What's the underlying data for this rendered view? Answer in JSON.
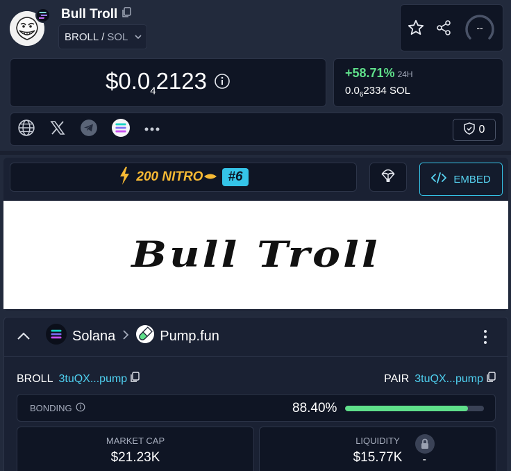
{
  "header": {
    "token_name": "Bull Troll",
    "base_symbol": "BROLL",
    "pair_separator": "/",
    "quote_symbol": "SOL",
    "score_label": "--"
  },
  "price": {
    "usd_prefix": "$0.0",
    "usd_zeros": "4",
    "usd_digits": "2123",
    "change_24h": "+58.71%",
    "change_label": "24H",
    "sol_prefix": "0.0",
    "sol_zeros": "6",
    "sol_digits": "2334",
    "sol_unit": "SOL"
  },
  "socials": {
    "icons": [
      "globe-icon",
      "x-icon",
      "telegram-icon",
      "solana-icon",
      "more-icon"
    ],
    "shield_count": "0"
  },
  "boost": {
    "nitro_amount": "200",
    "nitro_label": "NITRO",
    "rank": "#6",
    "embed_label": "EMBED"
  },
  "banner": {
    "text": "Bull Troll"
  },
  "info": {
    "chain": "Solana",
    "dex": "Pump.fun",
    "token_label": "BROLL",
    "token_address": "3tuQX...pump",
    "pair_label": "PAIR",
    "pair_address": "3tuQX...pump",
    "bonding_label": "BONDING",
    "bonding_pct": "88.40%",
    "bonding_fraction": 0.884,
    "market_cap_label": "MARKET CAP",
    "market_cap": "$21.23K",
    "liquidity_label": "LIQUIDITY",
    "liquidity": "$15.77K",
    "liquidity_locked": "-"
  },
  "colors": {
    "accent": "#35c4e8",
    "positive": "#5fdf8a",
    "nitro": "#f6b934"
  }
}
